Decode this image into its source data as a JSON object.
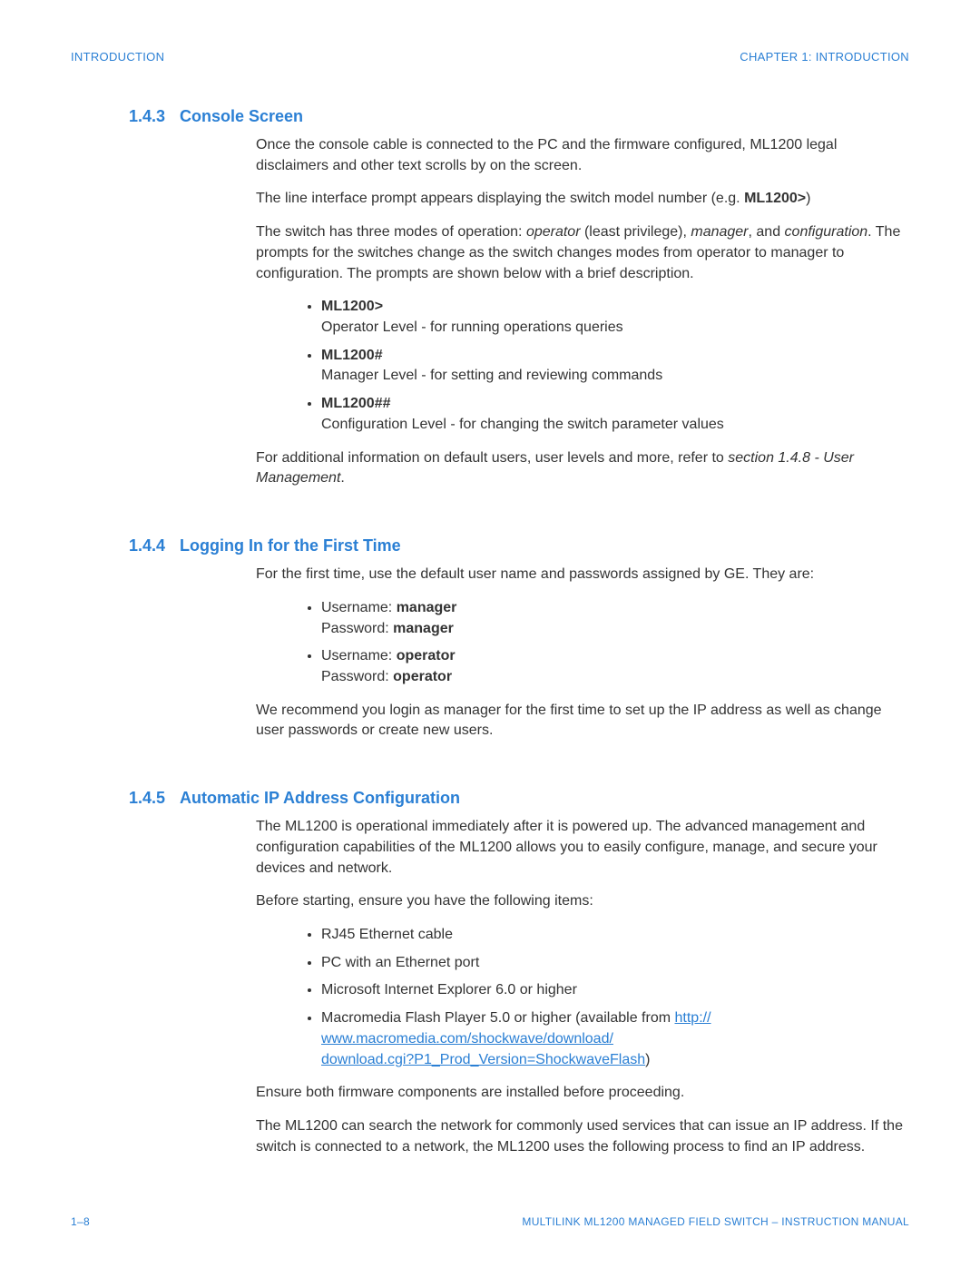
{
  "header": {
    "left": "INTRODUCTION",
    "right": "CHAPTER 1:  INTRODUCTION"
  },
  "footer": {
    "left": "1–8",
    "right": "MULTILINK ML1200 MANAGED FIELD SWITCH – INSTRUCTION MANUAL"
  },
  "s143": {
    "num": "1.4.3",
    "title": "Console Screen",
    "p1": "Once the console cable is connected to the PC and the firmware configured, ML1200 legal disclaimers and other text scrolls by on the screen.",
    "p2a": "The line interface prompt appears displaying the switch model number (e.g. ",
    "p2b": "ML1200>",
    "p2c": ")",
    "p3a": "The switch has three modes of operation: ",
    "p3b": "operator",
    "p3c": " (least privilege), ",
    "p3d": "manager",
    "p3e": ", and ",
    "p3f": "configuration",
    "p3g": ". The prompts for the switches change as the switch changes modes from operator to manager to configuration. The prompts are shown below with a brief description.",
    "b1t": "ML1200>",
    "b1s": "Operator Level - for running operations queries",
    "b2t": "ML1200#",
    "b2s": "Manager Level - for setting and reviewing commands",
    "b3t": "ML1200##",
    "b3s": "Configuration Level - for changing the switch parameter values",
    "p4a": "For additional information on default users, user levels and more, refer to ",
    "p4b": "section 1.4.8 - User Management",
    "p4c": "."
  },
  "s144": {
    "num": "1.4.4",
    "title": "Logging In for the First Time",
    "p1": "For the first time, use the default user name and passwords assigned by GE. They are:",
    "b1a": "Username: ",
    "b1b": "manager",
    "b1c": "Password: ",
    "b1d": "manager",
    "b2a": "Username: ",
    "b2b": "operator",
    "b2c": "Password: ",
    "b2d": "operator",
    "p2": "We recommend you login as manager for the first time to set up the IP address as well as change user passwords or create new users."
  },
  "s145": {
    "num": "1.4.5",
    "title": "Automatic IP Address Configuration",
    "p1": "The ML1200 is operational immediately after it is powered up. The advanced management and configuration capabilities of the ML1200 allows you to easily configure, manage, and secure your devices and network.",
    "p2": "Before starting, ensure you have the following items:",
    "i1": "RJ45 Ethernet cable",
    "i2": "PC with an Ethernet port",
    "i3": "Microsoft Internet Explorer 6.0 or higher",
    "i4a": "Macromedia Flash Player 5.0 or higher (available from ",
    "i4l1": "http://",
    "i4l2": "www.macromedia.com/shockwave/download/",
    "i4l3": "download.cgi?P1_Prod_Version=ShockwaveFlash",
    "i4b": ")",
    "p3": "Ensure both firmware components are installed before proceeding.",
    "p4": "The ML1200 can search the network for commonly used services that can issue an IP address. If the switch is connected to a network, the ML1200 uses the following process to find an IP address."
  }
}
